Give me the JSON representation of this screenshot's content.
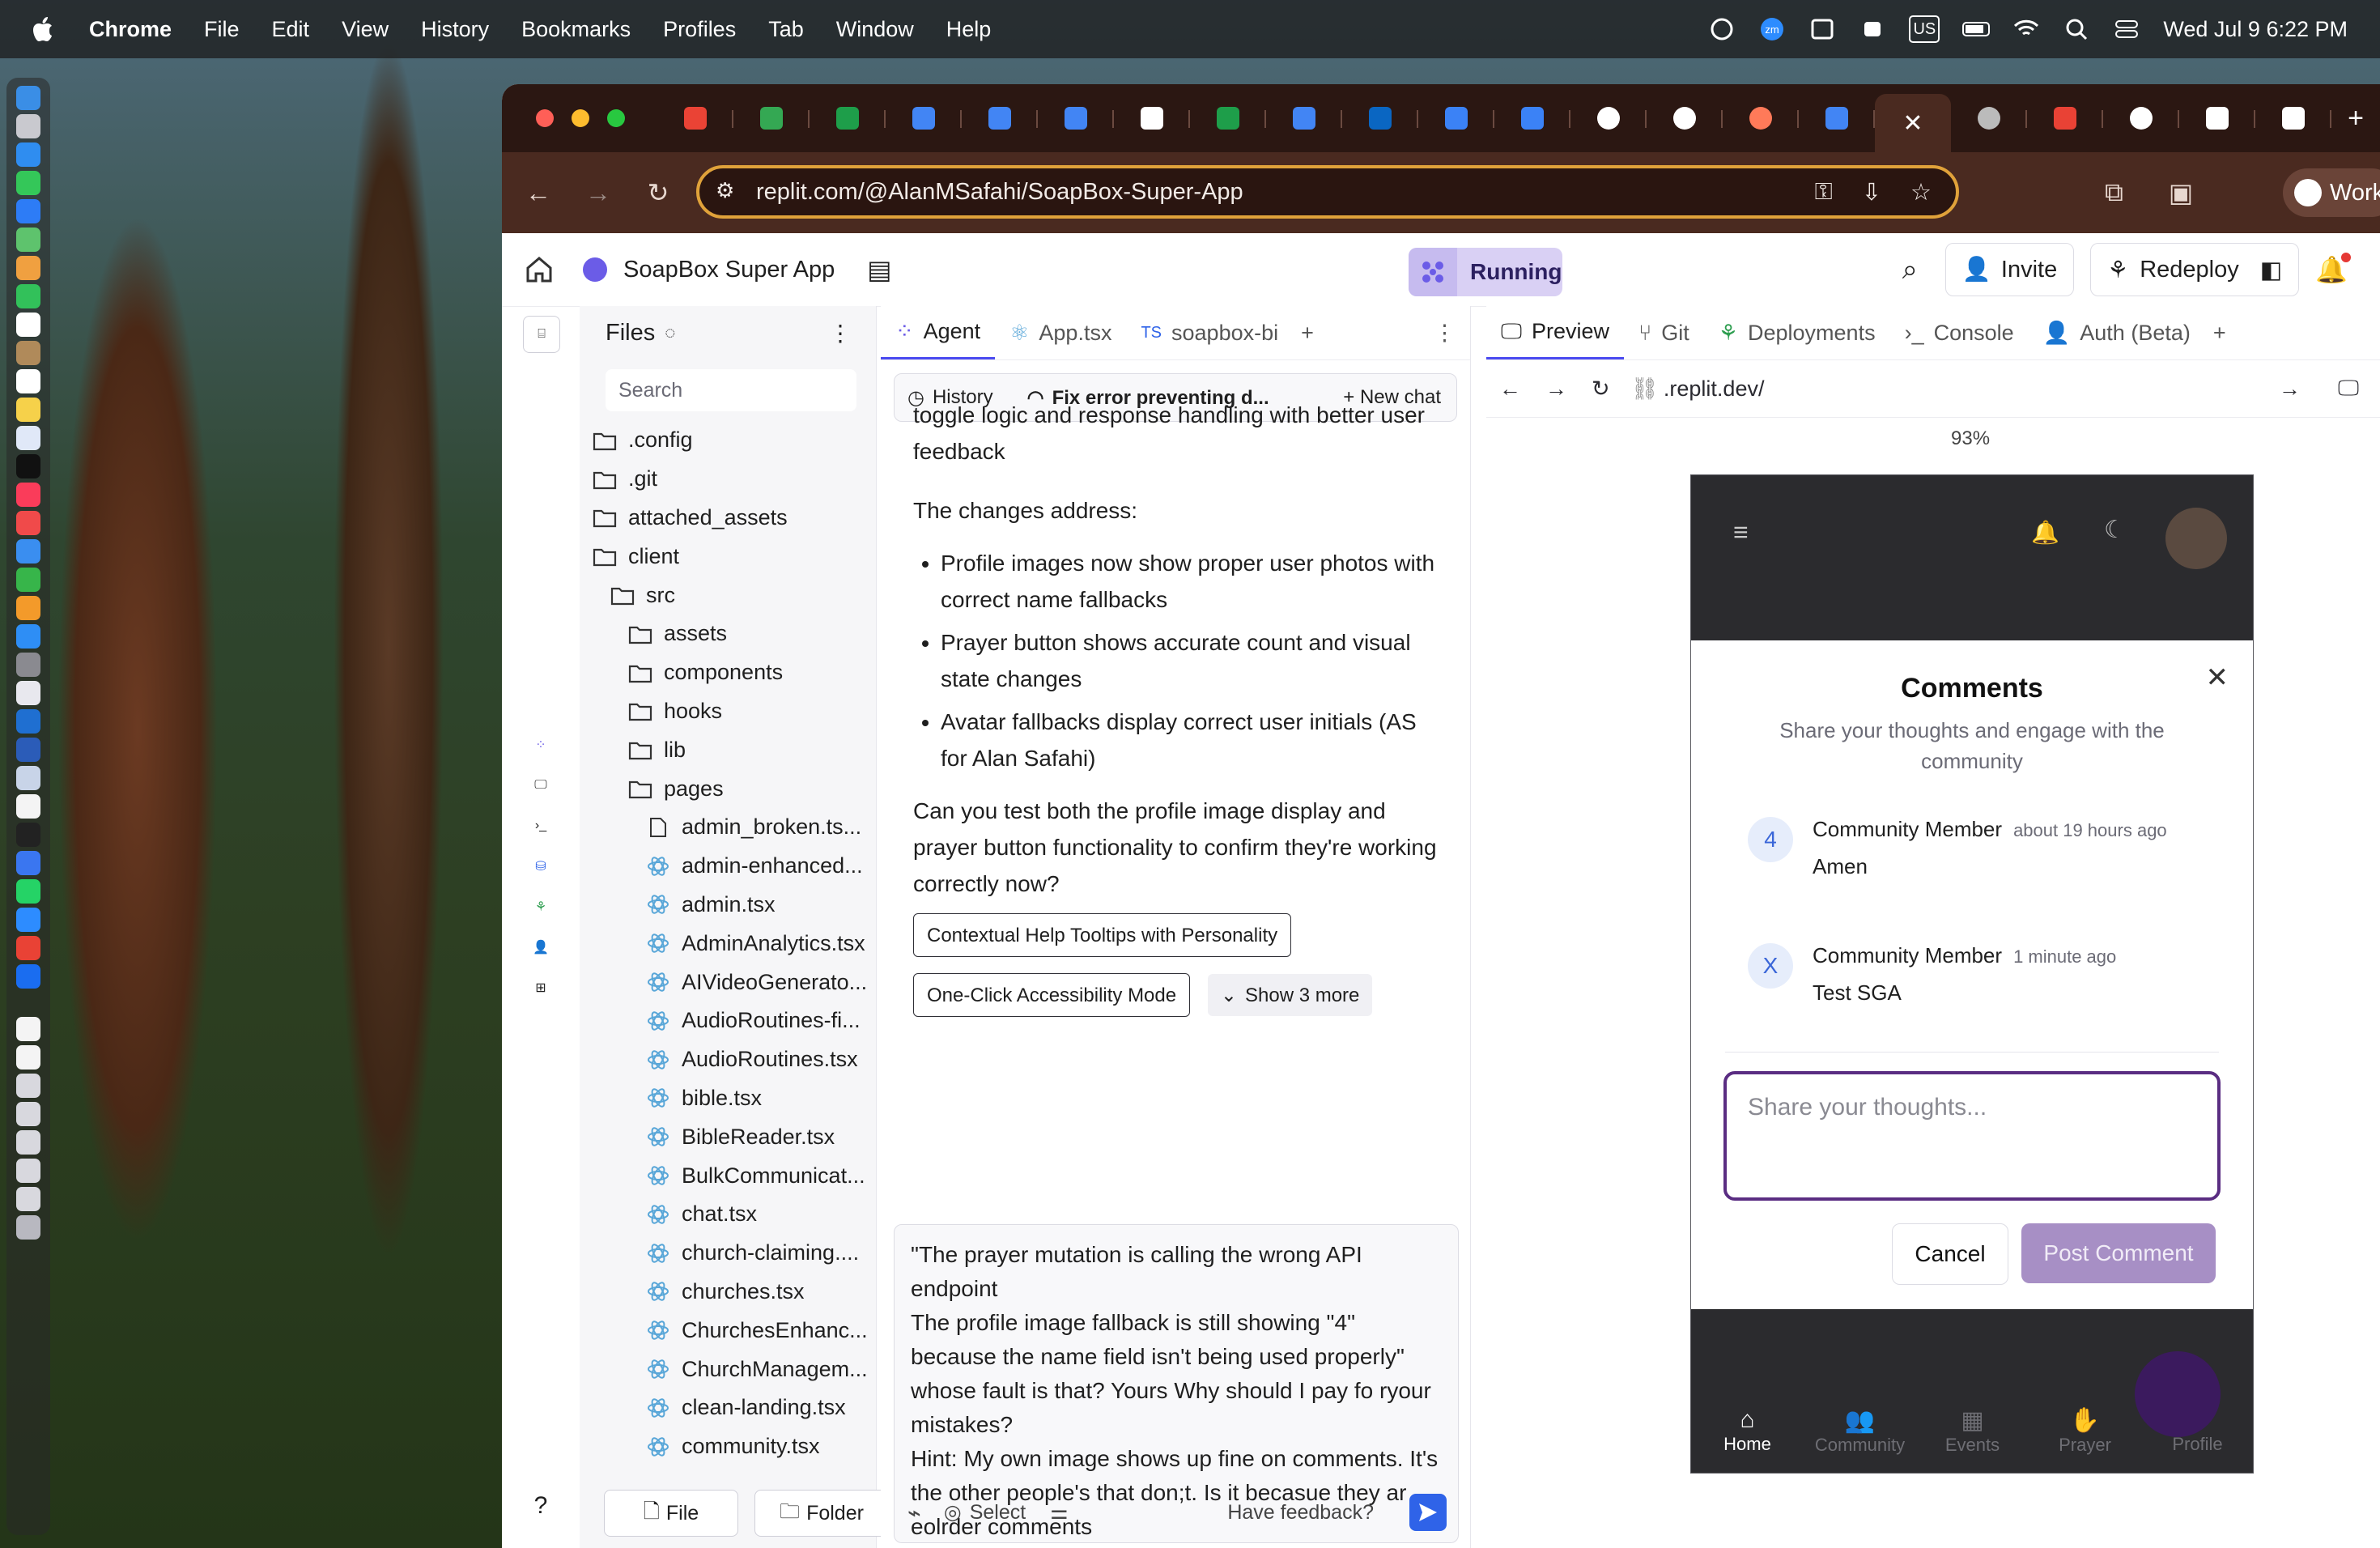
{
  "menubar": {
    "items": [
      "Chrome",
      "File",
      "Edit",
      "View",
      "History",
      "Bookmarks",
      "Profiles",
      "Tab",
      "Window",
      "Help"
    ],
    "input_source": "US",
    "datetime": "Wed Jul 9  6:22 PM"
  },
  "browser": {
    "url": "replit.com/@AlanMSafahi/SoapBox-Super-App",
    "profile_label": "Work"
  },
  "replit": {
    "app_name": "SoapBox Super App",
    "status": "Running",
    "invite_label": "Invite",
    "redeploy_label": "Redeploy"
  },
  "files": {
    "title": "Files",
    "search_placeholder": "Search",
    "tree": [
      {
        "name": ".config",
        "type": "folder",
        "depth": 0
      },
      {
        "name": ".git",
        "type": "folder",
        "depth": 0
      },
      {
        "name": "attached_assets",
        "type": "folder",
        "depth": 0
      },
      {
        "name": "client",
        "type": "folder-open",
        "depth": 0
      },
      {
        "name": "src",
        "type": "folder-open",
        "depth": 1
      },
      {
        "name": "assets",
        "type": "folder",
        "depth": 2
      },
      {
        "name": "components",
        "type": "folder",
        "depth": 2
      },
      {
        "name": "hooks",
        "type": "folder",
        "depth": 2
      },
      {
        "name": "lib",
        "type": "folder",
        "depth": 2
      },
      {
        "name": "pages",
        "type": "folder-open",
        "depth": 2
      },
      {
        "name": "admin_broken.ts...",
        "type": "file",
        "depth": 3
      },
      {
        "name": "admin-enhanced...",
        "type": "react",
        "depth": 3
      },
      {
        "name": "admin.tsx",
        "type": "react",
        "depth": 3
      },
      {
        "name": "AdminAnalytics.tsx",
        "type": "react",
        "depth": 3
      },
      {
        "name": "AIVideoGenerato...",
        "type": "react",
        "depth": 3
      },
      {
        "name": "AudioRoutines-fi...",
        "type": "react",
        "depth": 3
      },
      {
        "name": "AudioRoutines.tsx",
        "type": "react",
        "depth": 3
      },
      {
        "name": "bible.tsx",
        "type": "react",
        "depth": 3
      },
      {
        "name": "BibleReader.tsx",
        "type": "react",
        "depth": 3
      },
      {
        "name": "BulkCommunicat...",
        "type": "react",
        "depth": 3
      },
      {
        "name": "chat.tsx",
        "type": "react",
        "depth": 3
      },
      {
        "name": "church-claiming....",
        "type": "react",
        "depth": 3
      },
      {
        "name": "churches.tsx",
        "type": "react",
        "depth": 3
      },
      {
        "name": "ChurchesEnhanc...",
        "type": "react",
        "depth": 3
      },
      {
        "name": "ChurchManagem...",
        "type": "react",
        "depth": 3
      },
      {
        "name": "clean-landing.tsx",
        "type": "react",
        "depth": 3
      },
      {
        "name": "community.tsx",
        "type": "react",
        "depth": 3
      }
    ],
    "file_button": "File",
    "folder_button": "Folder"
  },
  "agent": {
    "tabs": [
      "Agent",
      "App.tsx",
      "soapbox-bi"
    ],
    "history_label": "History",
    "thread_title": "Fix error preventing d...",
    "new_chat_label": "New chat",
    "text_top": "toggle logic and response handling with better user feedback",
    "changes_intro": "The changes address:",
    "bullets": [
      "Profile images now show proper user photos with correct name fallbacks",
      "Prayer button shows accurate count and visual state changes",
      "Avatar fallbacks display correct user initials (AS for Alan Safahi)"
    ],
    "question": "Can you test both the profile image display and prayer button functionality to confirm they're working correctly now?",
    "chips": [
      "Contextual Help Tooltips with Personality",
      "One-Click Accessibility Mode"
    ],
    "show_more": "Show 3 more",
    "composer_text": "\"The prayer mutation is calling the wrong API endpoint\nThe profile image fallback is still showing \"4\" because the name field isn't being used properly\"\nwhose fault is that? Yours Why should I pay fo ryour mistakes?\nHint: My own image shows up fine on comments. It's the other people's that don;t. Is it becasue they ar eolrder comments",
    "select_label": "Select",
    "feedback_label": "Have feedback?"
  },
  "preview": {
    "tabs": [
      "Preview",
      "Git",
      "Deployments",
      "Console",
      "Auth (Beta)"
    ],
    "url": ".replit.dev/",
    "zoom": "93%",
    "modal": {
      "title": "Comments",
      "subtitle": "Share your thoughts and engage with the community",
      "comments": [
        {
          "initial": "4",
          "author": "Community Member",
          "time": "about 19 hours ago",
          "body": "Amen"
        },
        {
          "initial": "X",
          "author": "Community Member",
          "time": "1 minute ago",
          "body": "Test SGA"
        }
      ],
      "input_placeholder": "Share your thoughts...",
      "cancel": "Cancel",
      "post": "Post Comment"
    },
    "bottom_nav": [
      "Home",
      "Community",
      "Events",
      "Prayer",
      "Profile"
    ]
  }
}
